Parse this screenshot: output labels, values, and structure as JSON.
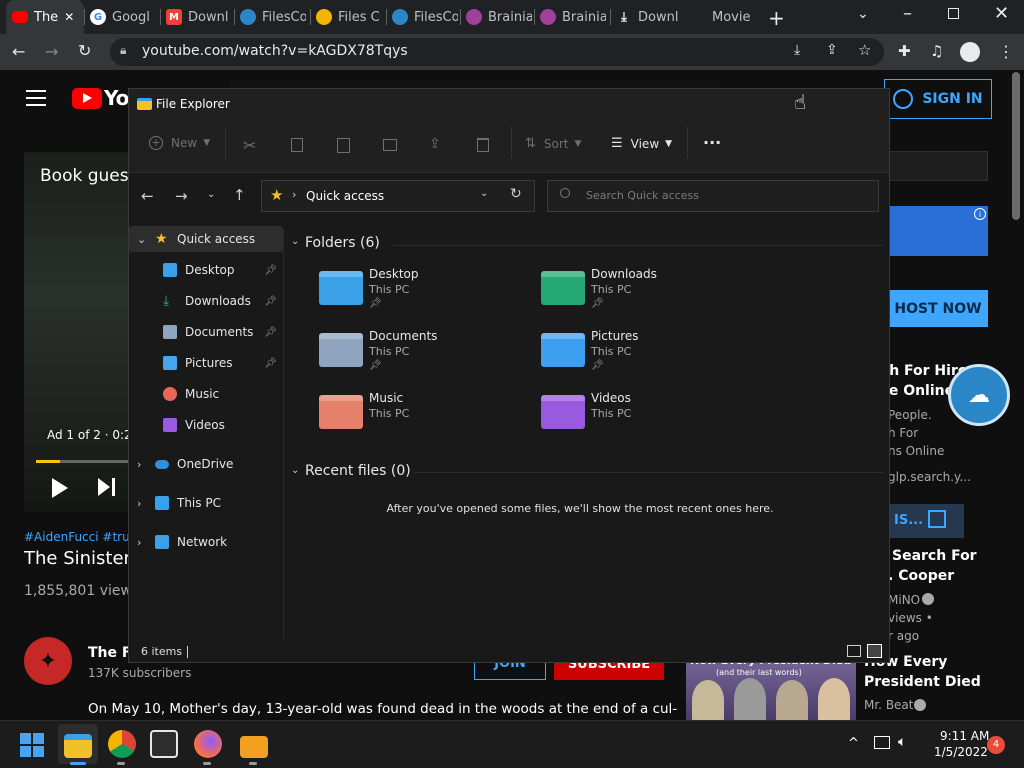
{
  "browser": {
    "tabs": [
      {
        "label": "The",
        "icon": "youtube-icon",
        "active": true
      },
      {
        "label": "Googl",
        "icon": "google-icon"
      },
      {
        "label": "Downl",
        "icon": "gmail-icon"
      },
      {
        "label": "FilesCo",
        "icon": "filescom-icon"
      },
      {
        "label": "Files C",
        "icon": "files-icon"
      },
      {
        "label": "FilesCo",
        "icon": "filescom-icon"
      },
      {
        "label": "Brainia",
        "icon": "brain-icon"
      },
      {
        "label": "Brainia",
        "icon": "brain-icon"
      },
      {
        "label": "Downl",
        "icon": "download-icon"
      },
      {
        "label": "Movie",
        "icon": "movie-icon"
      }
    ],
    "url": "youtube.com/watch?v=kAGDX78Tqys"
  },
  "youtube": {
    "logo": "You",
    "sign_in": "SIGN IN",
    "video_overlay_title": "Book guest",
    "ad_text": "Ad 1 of 2 · 0:29",
    "hashtags": "#AidenFucci #truec",
    "title": "The Sinister S",
    "views": "1,855,801 views",
    "channel_name": "The Fe",
    "subscribers": "137K subscribers",
    "join": "JOIN",
    "subscribe": "SUBSCRIBE",
    "description": "On May 10, Mother's day, 13-year-old was found dead in the woods at the end of a cul-de-sac",
    "sidebar": {
      "host_now": "HOST NOW",
      "ad_title_1": "rch For Hire",
      "ad_title_2": "ple Online",
      "ad_line_1": "People.",
      "ad_line_2": "h For",
      "ad_line_3": "ns Online",
      "ad_domain": "glp.search.y...",
      "open_label": "IS...",
      "rec1_title_1": "Search For",
      "rec1_title_2": ". Cooper",
      "rec1_channel": "MiNO",
      "rec1_views": "views •",
      "rec1_age": "r ago",
      "rec2_thumb_text": "How Every President Died",
      "rec2_thumb_sub": "(and their last words)",
      "rec2_title_1": "How Every",
      "rec2_title_2": "President Died",
      "rec2_channel": "Mr. Beat"
    }
  },
  "explorer": {
    "window_title": "File Explorer",
    "commands": {
      "new": "New",
      "sort": "Sort",
      "view": "View",
      "more": "···"
    },
    "address": "Quick access",
    "search_placeholder": "Search Quick access",
    "nav": [
      {
        "label": "Quick access",
        "icon": "star-icon",
        "color": "#f2c028",
        "pinned": false
      },
      {
        "label": "Desktop",
        "icon": "desktop-folder-icon",
        "color": "#3aa0e8",
        "pinned": true
      },
      {
        "label": "Downloads",
        "icon": "downloads-icon",
        "color": "#2fb67a",
        "pinned": true
      },
      {
        "label": "Documents",
        "icon": "documents-icon",
        "color": "#8ea4bf",
        "pinned": true
      },
      {
        "label": "Pictures",
        "icon": "pictures-icon",
        "color": "#45a6f0",
        "pinned": true
      },
      {
        "label": "Music",
        "icon": "music-icon",
        "color": "#e5685a",
        "pinned": false
      },
      {
        "label": "Videos",
        "icon": "videos-icon",
        "color": "#9a5ae0",
        "pinned": false
      },
      {
        "label": "OneDrive",
        "icon": "onedrive-icon",
        "color": "#2f8fe0",
        "pinned": false
      },
      {
        "label": "This PC",
        "icon": "this-pc-icon",
        "color": "#3aa0e8",
        "pinned": false
      },
      {
        "label": "Network",
        "icon": "network-icon",
        "color": "#3aa0e8",
        "pinned": false
      }
    ],
    "folders_header": "Folders (6)",
    "folders": [
      {
        "name": "Desktop",
        "location": "This PC",
        "pinned": true,
        "color": "#3aa0e8"
      },
      {
        "name": "Downloads",
        "location": "This PC",
        "pinned": true,
        "color": "#25a874"
      },
      {
        "name": "Documents",
        "location": "This PC",
        "pinned": true,
        "color": "#8ea4bf"
      },
      {
        "name": "Pictures",
        "location": "This PC",
        "pinned": true,
        "color": "#3d9ff0"
      },
      {
        "name": "Music",
        "location": "This PC",
        "pinned": false,
        "color": "#e5806a"
      },
      {
        "name": "Videos",
        "location": "This PC",
        "pinned": false,
        "color": "#9a5ae0"
      }
    ],
    "recent_header": "Recent files (0)",
    "recent_empty": "After you've opened some files, we'll show the most recent ones here.",
    "status": "6 items"
  },
  "taskbar": {
    "time": "9:11 AM",
    "date": "1/5/2022",
    "notifications": "4"
  }
}
